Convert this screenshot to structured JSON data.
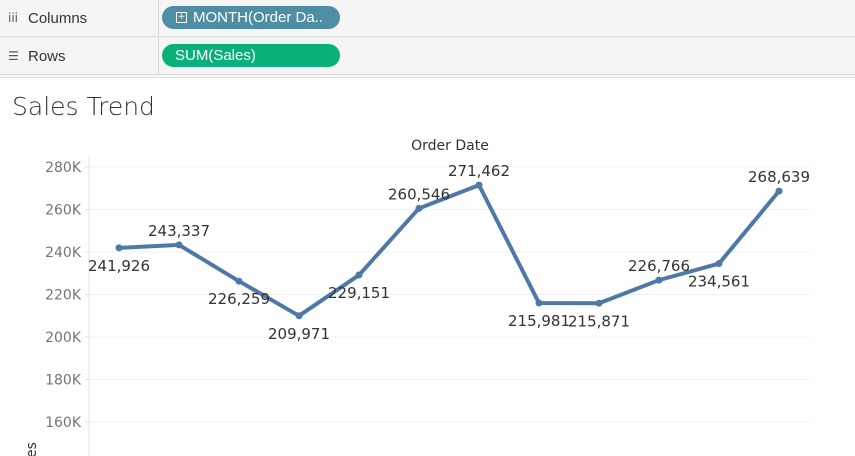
{
  "shelves": {
    "columns": {
      "label": "Columns",
      "icon": "columns-icon",
      "pill": "MONTH(Order Da..",
      "pill_icon": "plus-box-icon",
      "pill_color": "#4d8ea4"
    },
    "rows": {
      "label": "Rows",
      "icon": "rows-icon",
      "pill": "SUM(Sales)",
      "pill_color": "#09b07a"
    }
  },
  "sheet": {
    "title": "Sales Trend"
  },
  "chart_data": {
    "type": "line",
    "title": "Order Date",
    "xlabel": "Order Date",
    "ylabel": "Sales",
    "ylabel_visible": "es",
    "line_color": "#4e79a7",
    "x": [
      "1",
      "2",
      "3",
      "4",
      "5",
      "6",
      "7",
      "8",
      "9",
      "10",
      "11",
      "12"
    ],
    "series": [
      {
        "name": "",
        "values": [
          241926,
          243337,
          226259,
          209971,
          229151,
          260546,
          271462,
          215981,
          215871,
          226766,
          234561,
          268639
        ],
        "labels": [
          "241,926",
          "243,337",
          "226,259",
          "209,971",
          "229,151",
          "260,546",
          "271,462",
          "215,981",
          "215,871",
          "226,766",
          "234,561",
          "268,639"
        ],
        "label_positions": [
          "below",
          "above",
          "below",
          "below",
          "below",
          "above",
          "above",
          "below",
          "below",
          "above",
          "below",
          "above"
        ]
      }
    ],
    "yticks": [
      160000,
      180000,
      200000,
      220000,
      240000,
      260000,
      280000
    ],
    "ytick_labels": [
      "160K",
      "180K",
      "200K",
      "220K",
      "240K",
      "260K",
      "280K"
    ],
    "grid": true
  }
}
